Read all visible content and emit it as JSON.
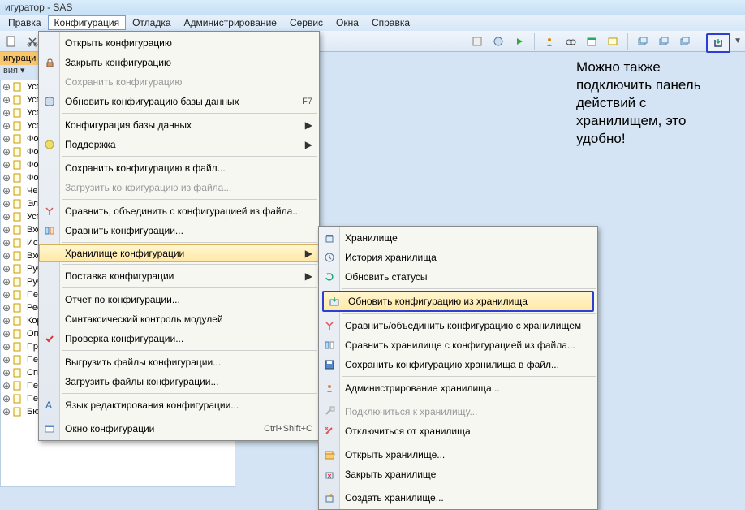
{
  "window": {
    "title": "игуратор - SAS"
  },
  "menubar": [
    "Правка",
    "Конфигурация",
    "Отладка",
    "Администрирование",
    "Сервис",
    "Окна",
    "Справка"
  ],
  "menubar_active_index": 1,
  "panel": {
    "title": "игураци",
    "sub": "вия ▾"
  },
  "tree": [
    {
      "t": "Уст",
      "lock": false
    },
    {
      "t": "Уст",
      "lock": false
    },
    {
      "t": "Уст",
      "lock": false
    },
    {
      "t": "Уст",
      "lock": false
    },
    {
      "t": "Фо",
      "lock": false
    },
    {
      "t": "Фо",
      "lock": false
    },
    {
      "t": "Фо",
      "lock": false
    },
    {
      "t": "Фо",
      "lock": false
    },
    {
      "t": "Чек",
      "lock": false
    },
    {
      "t": "Эле",
      "lock": false
    },
    {
      "t": "Уст",
      "lock": false
    },
    {
      "t": "Вхо",
      "lock": false
    },
    {
      "t": "Исх",
      "lock": false
    },
    {
      "t": "Вхо",
      "lock": false
    },
    {
      "t": "Руч",
      "lock": false
    },
    {
      "t": "Руч",
      "lock": false
    },
    {
      "t": "Пер",
      "lock": false
    },
    {
      "t": "Рес",
      "lock": false
    },
    {
      "t": "Кор",
      "lock": false
    },
    {
      "t": "Опе",
      "lock": false
    },
    {
      "t": "ПринятиеКУчетуОС",
      "lock": true
    },
    {
      "t": "ПеремещениеОС",
      "lock": true
    },
    {
      "t": "СписаниеОС",
      "lock": true
    },
    {
      "t": "ПередачаОС",
      "lock": true
    },
    {
      "t": "ПереоценкаОС",
      "lock": true
    },
    {
      "t": "БюджетДоходовИРасходов",
      "lock": true
    }
  ],
  "menu1": [
    {
      "label": "Открыть конфигурацию",
      "type": "item"
    },
    {
      "label": "Закрыть конфигурацию",
      "type": "item",
      "icon": "lock"
    },
    {
      "label": "Сохранить конфигурацию",
      "type": "item",
      "disabled": true
    },
    {
      "label": "Обновить конфигурацию базы данных",
      "type": "item",
      "shortcut": "F7",
      "icon": "db"
    },
    {
      "type": "sep"
    },
    {
      "label": "Конфигурация базы данных",
      "type": "sub"
    },
    {
      "label": "Поддержка",
      "type": "sub",
      "icon": "support"
    },
    {
      "type": "sep"
    },
    {
      "label": "Сохранить конфигурацию в файл...",
      "type": "item"
    },
    {
      "label": "Загрузить конфигурацию из файла...",
      "type": "item",
      "disabled": true
    },
    {
      "type": "sep"
    },
    {
      "label": "Сравнить, объединить с конфигурацией из файла...",
      "type": "item",
      "icon": "merge"
    },
    {
      "label": "Сравнить конфигурации...",
      "type": "item",
      "icon": "compare"
    },
    {
      "type": "sep"
    },
    {
      "label": "Хранилище конфигурации",
      "type": "sub",
      "hover": true
    },
    {
      "type": "sep"
    },
    {
      "label": "Поставка конфигурации",
      "type": "sub"
    },
    {
      "type": "sep"
    },
    {
      "label": "Отчет по конфигурации...",
      "type": "item"
    },
    {
      "label": "Синтаксический контроль модулей",
      "type": "item"
    },
    {
      "label": "Проверка конфигурации...",
      "type": "item",
      "icon": "check"
    },
    {
      "type": "sep"
    },
    {
      "label": "Выгрузить файлы конфигурации...",
      "type": "item"
    },
    {
      "label": "Загрузить файлы конфигурации...",
      "type": "item"
    },
    {
      "type": "sep"
    },
    {
      "label": "Язык редактирования конфигурации...",
      "type": "item",
      "icon": "lang"
    },
    {
      "type": "sep"
    },
    {
      "label": "Окно конфигурации",
      "type": "item",
      "shortcut": "Ctrl+Shift+C",
      "icon": "win"
    }
  ],
  "menu2": [
    {
      "label": "Хранилище",
      "icon": "store"
    },
    {
      "label": "История хранилища",
      "icon": "hist"
    },
    {
      "label": "Обновить статусы",
      "icon": "refresh"
    },
    {
      "type": "sep"
    },
    {
      "label": "Обновить конфигурацию из хранилища",
      "highlight": true,
      "icon": "update"
    },
    {
      "type": "sep"
    },
    {
      "label": "Сравнить/объединить конфигурацию с хранилищем",
      "icon": "merge"
    },
    {
      "label": "Сравнить хранилище с конфигурацией из файла...",
      "icon": "compare2"
    },
    {
      "label": "Сохранить конфигурацию хранилища в файл...",
      "icon": "save"
    },
    {
      "type": "sep"
    },
    {
      "label": "Администрирование хранилища...",
      "icon": "admin"
    },
    {
      "type": "sep"
    },
    {
      "label": "Подключиться к хранилищу...",
      "disabled": true,
      "icon": "conn"
    },
    {
      "label": "Отключиться от хранилища",
      "icon": "disc"
    },
    {
      "type": "sep"
    },
    {
      "label": "Открыть хранилище...",
      "icon": "open"
    },
    {
      "label": "Закрыть хранилище",
      "icon": "close"
    },
    {
      "type": "sep"
    },
    {
      "label": "Создать хранилище...",
      "icon": "new"
    }
  ],
  "annotation": "Можно также подключить панель действий с хранилищем, это удобно!"
}
